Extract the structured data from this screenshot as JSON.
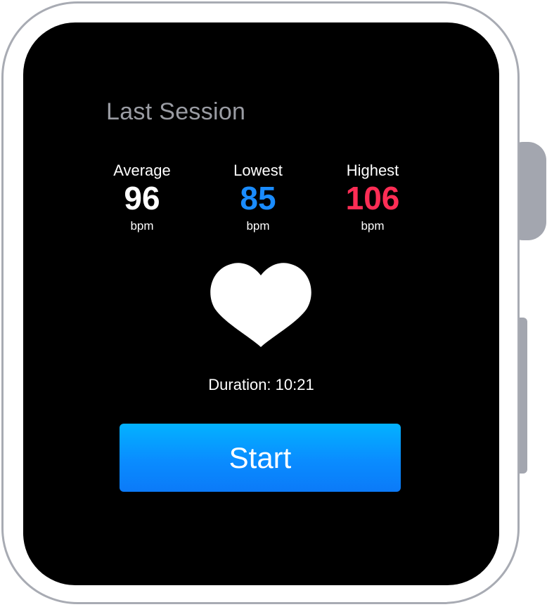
{
  "screen": {
    "title": "Last Session"
  },
  "stats": [
    {
      "label": "Average",
      "value": "96",
      "unit": "bpm",
      "color": "#ffffff"
    },
    {
      "label": "Lowest",
      "value": "85",
      "unit": "bpm",
      "color": "#1a8cff"
    },
    {
      "label": "Highest",
      "value": "106",
      "unit": "bpm",
      "color": "#ff2d55"
    }
  ],
  "heart_icon": "heart-icon",
  "duration": {
    "text": "Duration: 10:21"
  },
  "start_button": {
    "label": "Start",
    "color": "#0a8cff"
  },
  "watch": {
    "case_color": "#a8abb3",
    "screen_color": "#000000"
  }
}
